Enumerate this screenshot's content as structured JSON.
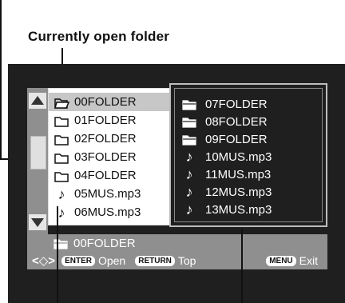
{
  "annotation": {
    "title": "Currently open folder"
  },
  "left_panel": {
    "items": [
      {
        "label": "00FOLDER",
        "icon": "open-folder-icon",
        "selected": true
      },
      {
        "label": "01FOLDER",
        "icon": "folder-icon"
      },
      {
        "label": "02FOLDER",
        "icon": "folder-icon"
      },
      {
        "label": "03FOLDER",
        "icon": "folder-icon"
      },
      {
        "label": "04FOLDER",
        "icon": "folder-icon"
      },
      {
        "label": "05MUS.mp3",
        "icon": "music-note-icon"
      },
      {
        "label": "06MUS.mp3",
        "icon": "music-note-icon"
      }
    ]
  },
  "right_panel": {
    "items": [
      {
        "label": "07FOLDER",
        "icon": "folder-icon"
      },
      {
        "label": "08FOLDER",
        "icon": "folder-icon"
      },
      {
        "label": "09FOLDER",
        "icon": "folder-icon"
      },
      {
        "label": "10MUS.mp3",
        "icon": "music-note-icon"
      },
      {
        "label": "11MUS.mp3",
        "icon": "music-note-icon"
      },
      {
        "label": "12MUS.mp3",
        "icon": "music-note-icon"
      },
      {
        "label": "13MUS.mp3",
        "icon": "music-note-icon"
      }
    ]
  },
  "path_bar": {
    "label": "00FOLDER",
    "icon": "folder-icon"
  },
  "bottom_bar": {
    "enter_badge": "ENTER",
    "enter_label": "Open",
    "return_badge": "RETURN",
    "return_label": "Top",
    "menu_badge": "MENU",
    "menu_label": "Exit"
  }
}
